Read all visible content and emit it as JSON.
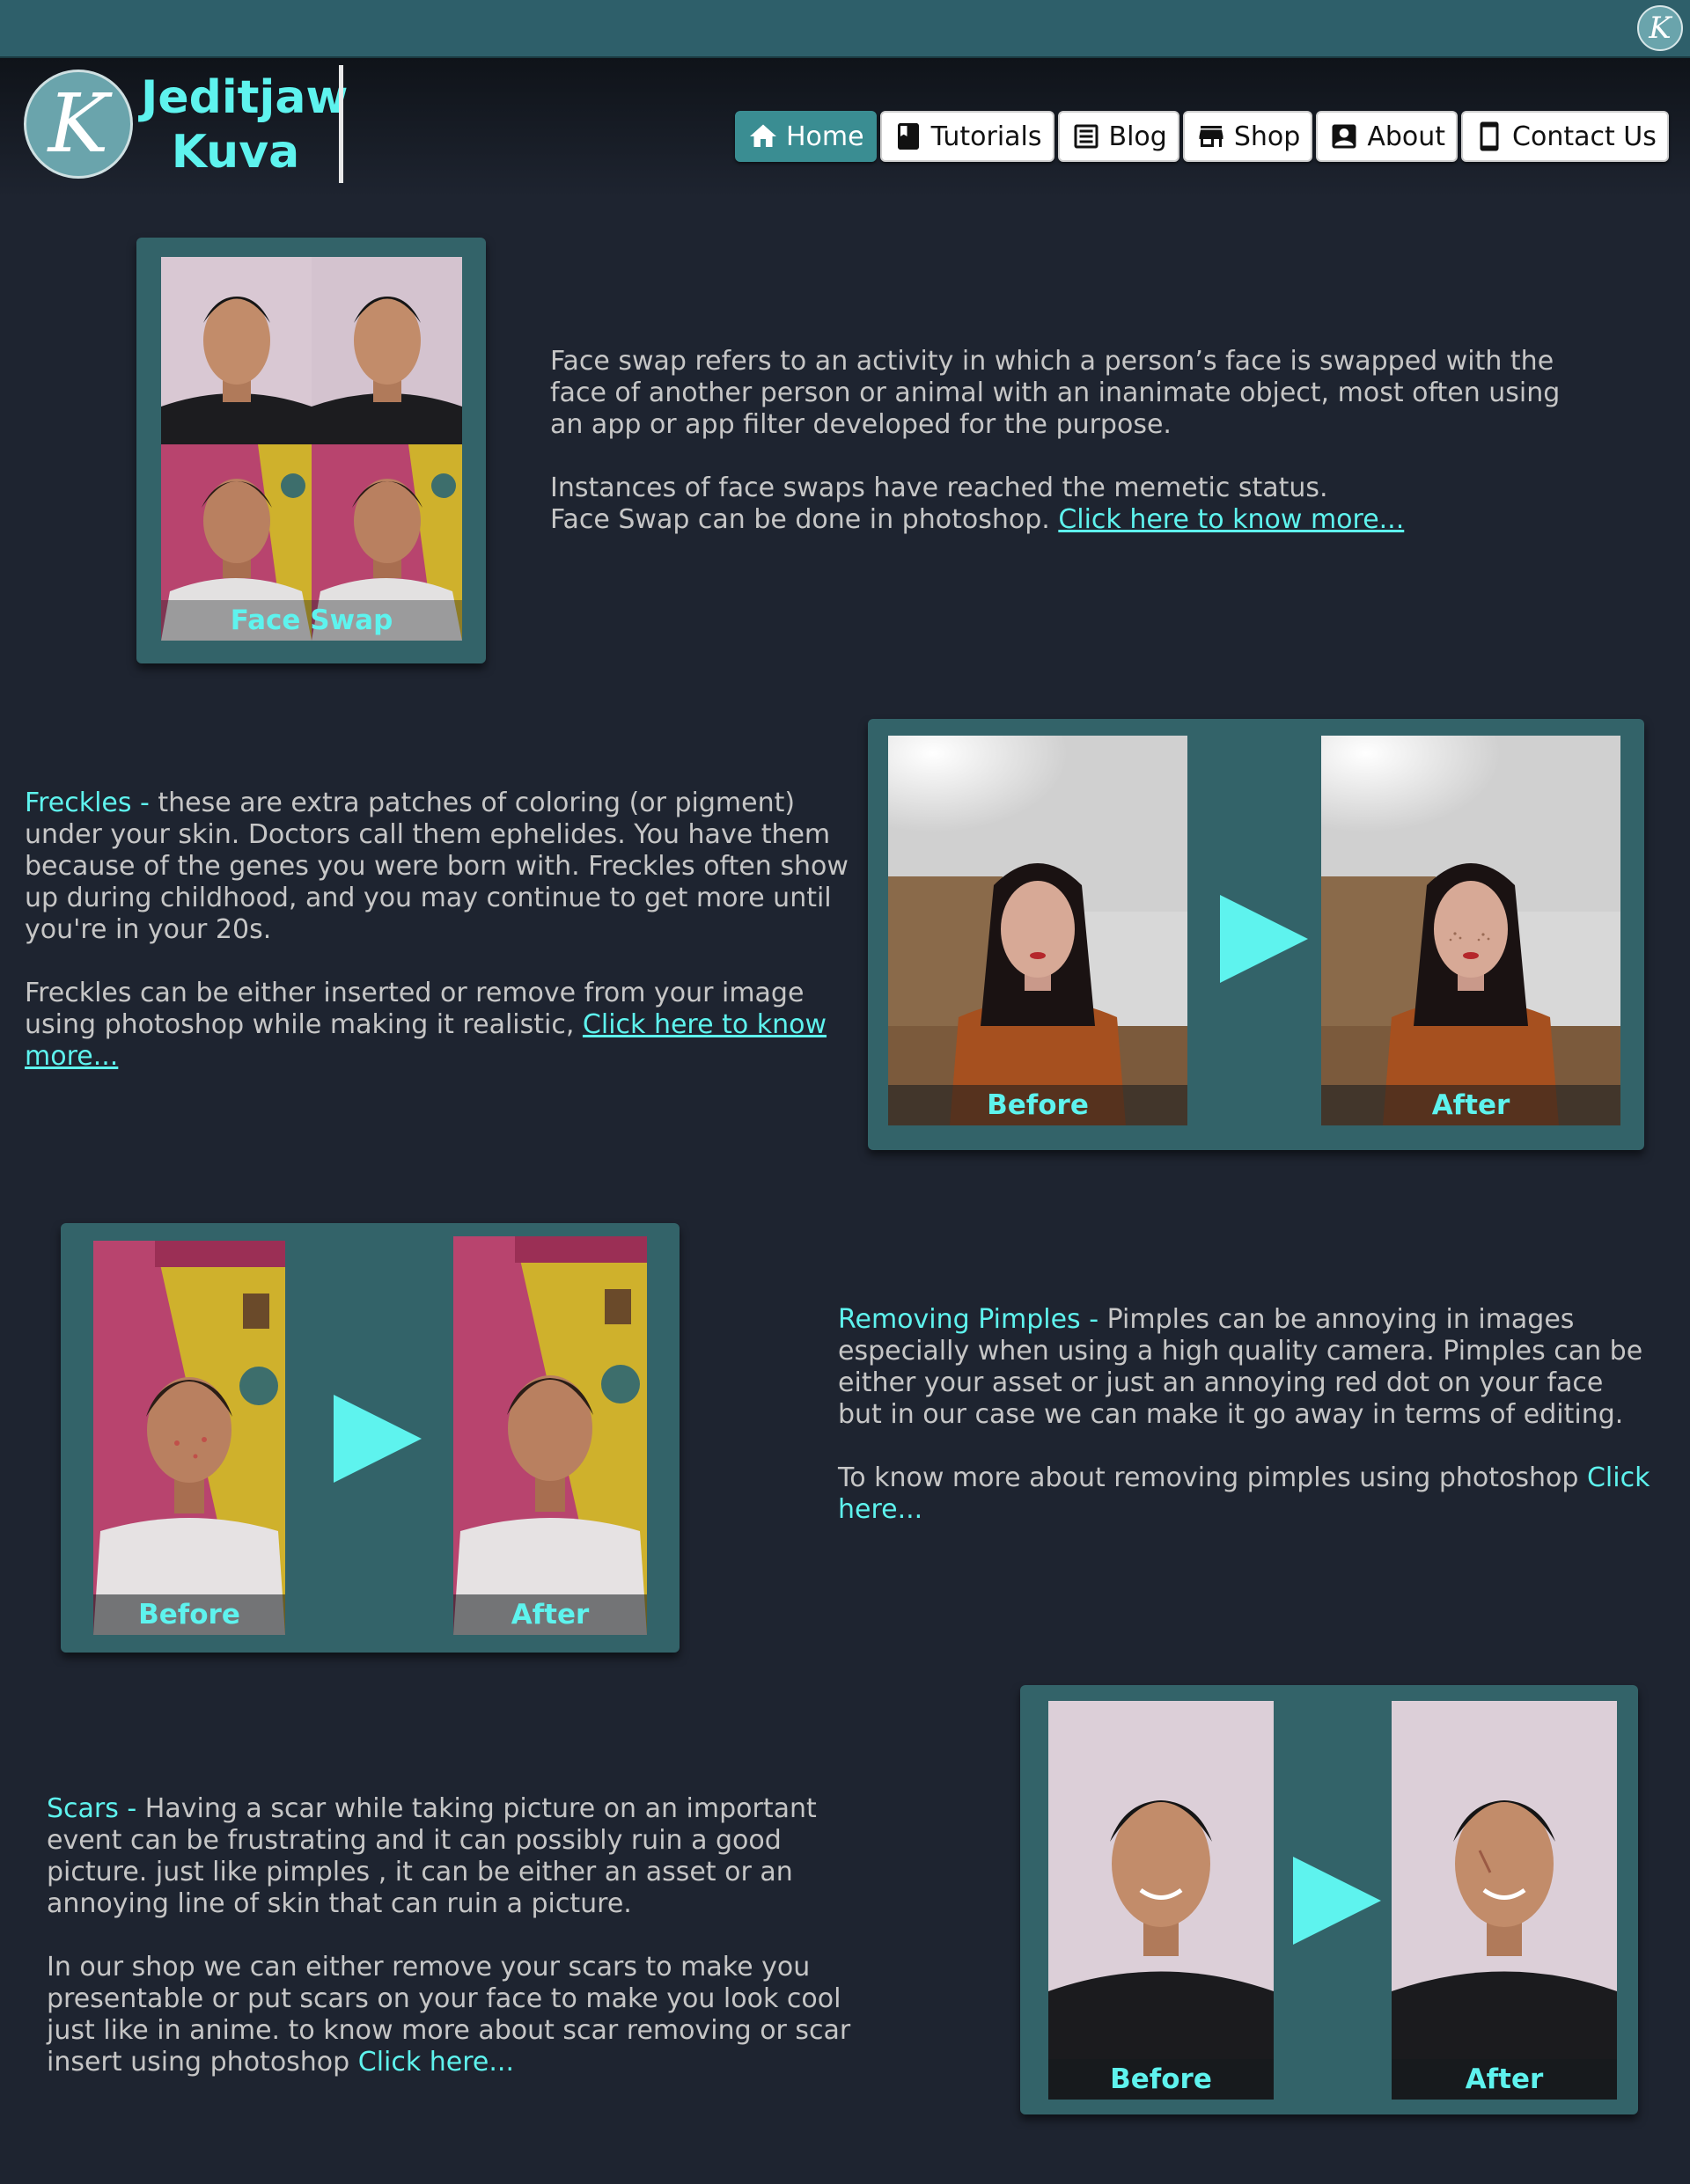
{
  "brand": {
    "line1": "Jeditjaw",
    "line2": "Kuva",
    "logo_letter": "K"
  },
  "nav": {
    "items": [
      {
        "label": "Home",
        "icon": "home-icon"
      },
      {
        "label": "Tutorials",
        "icon": "book-icon"
      },
      {
        "label": "Blog",
        "icon": "article-icon"
      },
      {
        "label": "Shop",
        "icon": "store-icon"
      },
      {
        "label": "About",
        "icon": "contact-card-icon"
      },
      {
        "label": "Contact Us",
        "icon": "phone-icon"
      }
    ],
    "active": "Home"
  },
  "sections": {
    "face_swap": {
      "caption": "Face Swap",
      "p1": "Face swap refers to an activity in which a person’s face is swapped with the face of another person or animal with an inanimate object, most often using an app or app filter developed for the purpose.",
      "p2": "Instances of face swaps have reached the memetic status.",
      "p3": "Face Swap can be done in photoshop. ",
      "link": "Click here to know more..."
    },
    "freckles": {
      "title": "Freckles - ",
      "p1": "these are extra patches of coloring (or pigment) under your skin. Doctors call them ephelides. You have them because of the genes you were born with. Freckles often show up during childhood, and you may continue to get more until you're in your 20s.",
      "p2": "Freckles can be either inserted or remove from your image using photoshop while making it realistic, ",
      "link": "Click here to know more...",
      "before": "Before",
      "after": "After"
    },
    "pimples": {
      "title": "Removing Pimples - ",
      "p1": "Pimples can be annoying in images especially when using a high quality camera. Pimples can be either your asset or just an annoying red dot on your face but in our case we can make it go away in terms of editing.",
      "p2": "To know more about removing pimples using photoshop ",
      "link": "Click here...",
      "before": "Before",
      "after": "After"
    },
    "scars": {
      "title": "Scars - ",
      "p1": "Having a scar while taking picture on an important event can be frustrating and it can possibly ruin a good picture. just like pimples , it can be either an asset or an annoying line of skin that can ruin a picture.",
      "p2": "In our shop we can either remove your scars to make you presentable or put scars on your face to make you look cool just like in anime. to know more about scar removing or scar insert using photoshop ",
      "link": "Click here...",
      "before": "Before",
      "after": "After"
    }
  },
  "colors": {
    "accent": "#5ef3ee",
    "card": "#336369",
    "background": "#1e2430",
    "topbar": "#2e5f6a"
  }
}
